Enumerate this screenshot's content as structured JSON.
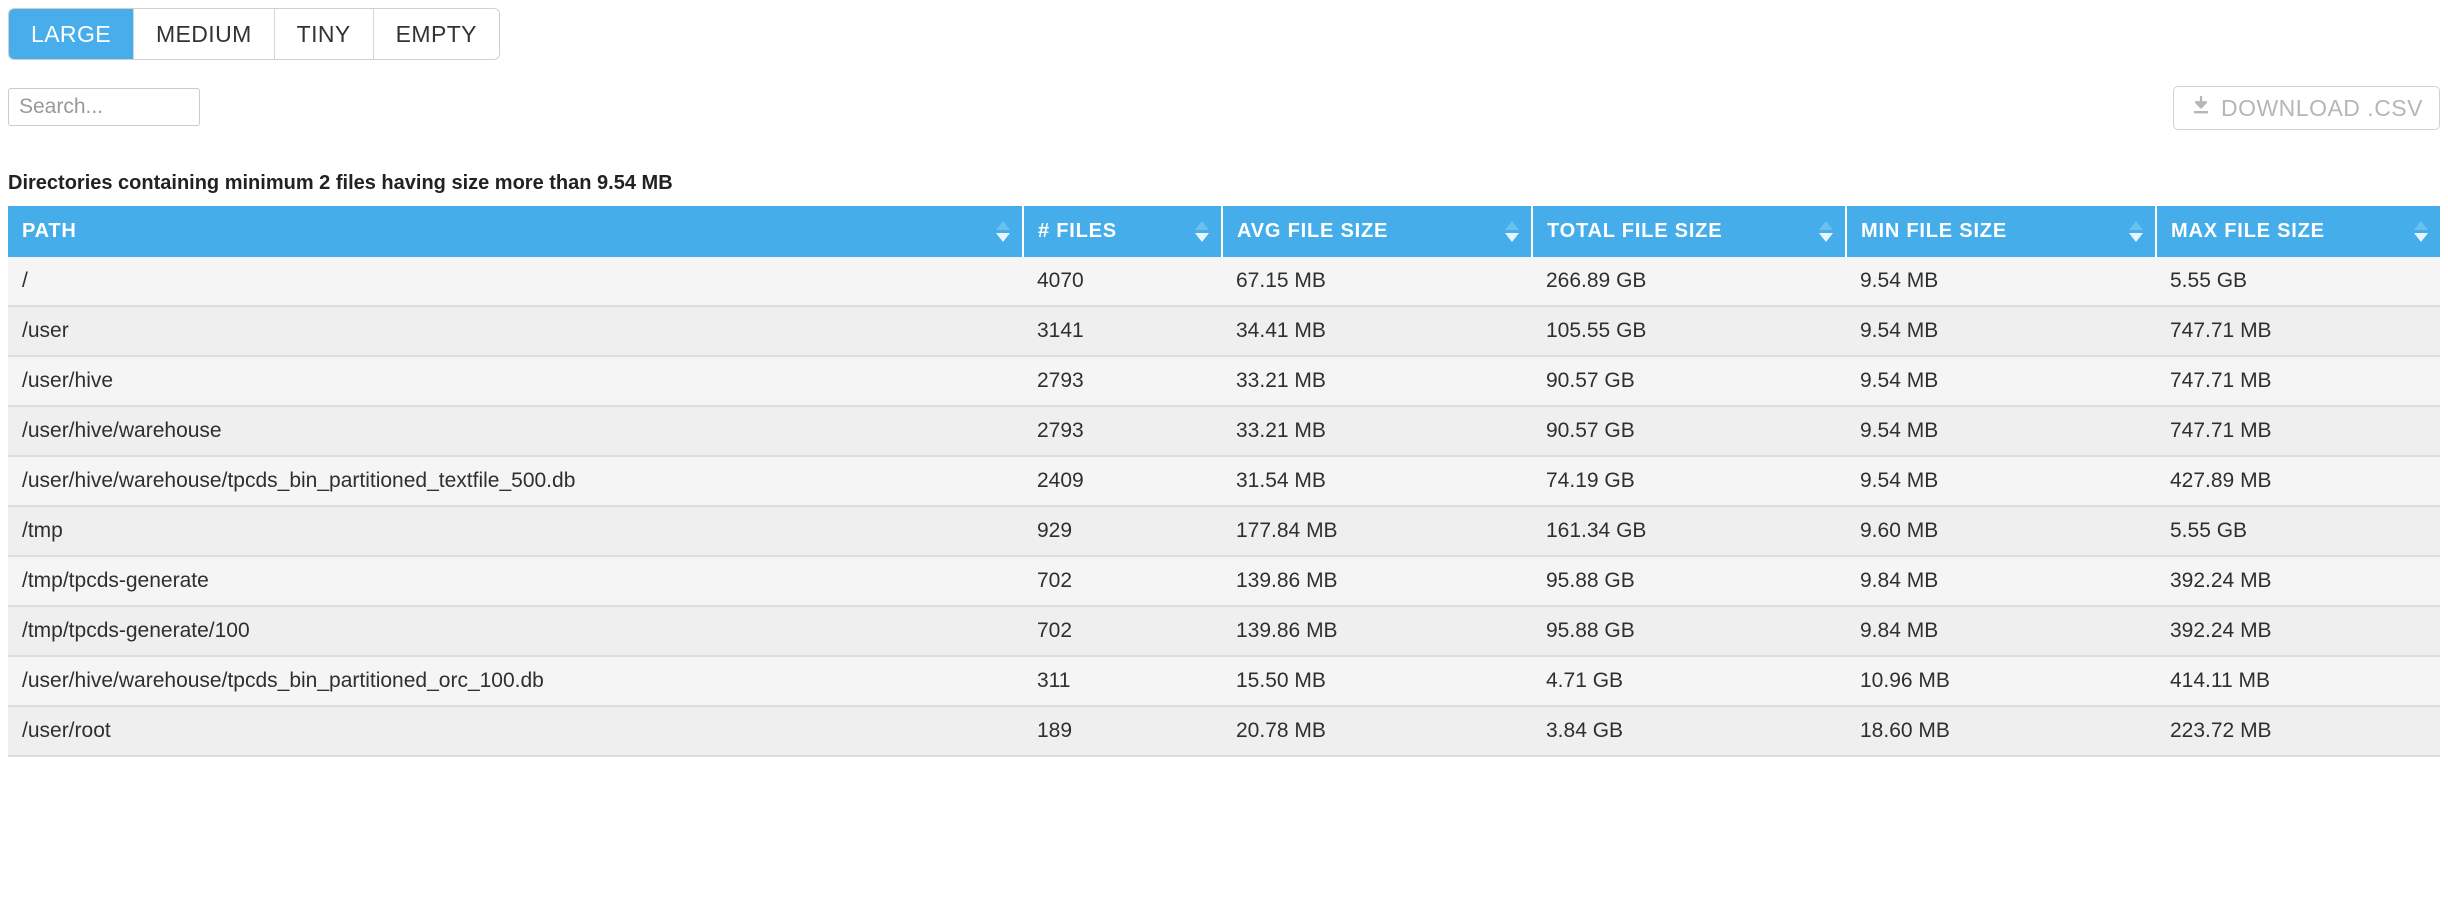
{
  "tabs": [
    {
      "label": "LARGE",
      "active": true
    },
    {
      "label": "MEDIUM",
      "active": false
    },
    {
      "label": "TINY",
      "active": false
    },
    {
      "label": "EMPTY",
      "active": false
    }
  ],
  "search": {
    "value": "",
    "placeholder": "Search..."
  },
  "download": {
    "label": "DOWNLOAD .CSV",
    "icon": "download-icon"
  },
  "caption": {
    "prefix": "Directories containing minimum ",
    "min_files": "2",
    "middle": " files having size more than ",
    "min_size": "9.54 MB"
  },
  "colors": {
    "header_blue": "#45ade9",
    "active_tab_blue": "#47aeeb",
    "row_odd": "#f5f5f5",
    "row_even": "#efefef",
    "row_border": "#dddddd",
    "muted_text": "#b6b6b6"
  },
  "table": {
    "columns": [
      {
        "label": "PATH",
        "sortable": true
      },
      {
        "label": "# FILES",
        "sortable": true
      },
      {
        "label": "AVG FILE SIZE",
        "sortable": true
      },
      {
        "label": "TOTAL FILE SIZE",
        "sortable": true
      },
      {
        "label": "MIN FILE SIZE",
        "sortable": true
      },
      {
        "label": "MAX FILE SIZE",
        "sortable": true
      }
    ],
    "rows": [
      {
        "path": "/",
        "files": "4070",
        "avg": "67.15 MB",
        "total": "266.89 GB",
        "min": "9.54 MB",
        "max": "5.55 GB"
      },
      {
        "path": "/user",
        "files": "3141",
        "avg": "34.41 MB",
        "total": "105.55 GB",
        "min": "9.54 MB",
        "max": "747.71 MB"
      },
      {
        "path": "/user/hive",
        "files": "2793",
        "avg": "33.21 MB",
        "total": "90.57 GB",
        "min": "9.54 MB",
        "max": "747.71 MB"
      },
      {
        "path": "/user/hive/warehouse",
        "files": "2793",
        "avg": "33.21 MB",
        "total": "90.57 GB",
        "min": "9.54 MB",
        "max": "747.71 MB"
      },
      {
        "path": "/user/hive/warehouse/tpcds_bin_partitioned_textfile_500.db",
        "files": "2409",
        "avg": "31.54 MB",
        "total": "74.19 GB",
        "min": "9.54 MB",
        "max": "427.89 MB"
      },
      {
        "path": "/tmp",
        "files": "929",
        "avg": "177.84 MB",
        "total": "161.34 GB",
        "min": "9.60 MB",
        "max": "5.55 GB"
      },
      {
        "path": "/tmp/tpcds-generate",
        "files": "702",
        "avg": "139.86 MB",
        "total": "95.88 GB",
        "min": "9.84 MB",
        "max": "392.24 MB"
      },
      {
        "path": "/tmp/tpcds-generate/100",
        "files": "702",
        "avg": "139.86 MB",
        "total": "95.88 GB",
        "min": "9.84 MB",
        "max": "392.24 MB"
      },
      {
        "path": "/user/hive/warehouse/tpcds_bin_partitioned_orc_100.db",
        "files": "311",
        "avg": "15.50 MB",
        "total": "4.71 GB",
        "min": "10.96 MB",
        "max": "414.11 MB"
      },
      {
        "path": "/user/root",
        "files": "189",
        "avg": "20.78 MB",
        "total": "3.84 GB",
        "min": "18.60 MB",
        "max": "223.72 MB"
      }
    ]
  }
}
